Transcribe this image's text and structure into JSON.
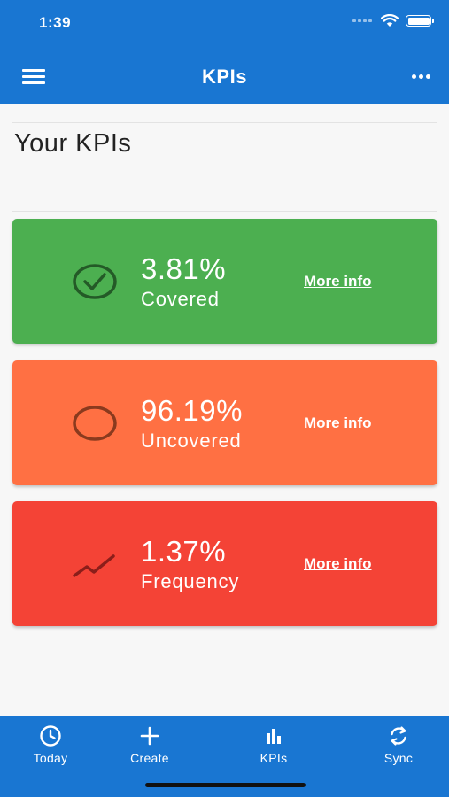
{
  "status_bar": {
    "time": "1:39"
  },
  "app_bar": {
    "title": "KPIs"
  },
  "page": {
    "heading": "Your KPIs"
  },
  "kpis": [
    {
      "value": "3.81%",
      "label": "Covered",
      "link": "More info",
      "icon": "check-circle-icon",
      "color": "#4caf50"
    },
    {
      "value": "96.19%",
      "label": "Uncovered",
      "link": "More info",
      "icon": "circle-outline-icon",
      "color": "#ff7043"
    },
    {
      "value": "1.37%",
      "label": "Frequency",
      "link": "More info",
      "icon": "trend-line-icon",
      "color": "#f44336"
    }
  ],
  "bottom_nav": {
    "items": [
      {
        "label": "Today",
        "icon": "clock-icon"
      },
      {
        "label": "Create",
        "icon": "plus-icon"
      },
      {
        "label": "KPIs",
        "icon": "bar-chart-icon"
      },
      {
        "label": "Sync",
        "icon": "sync-icon"
      }
    ]
  },
  "colors": {
    "primary": "#1976d2",
    "background": "#f7f7f7"
  }
}
